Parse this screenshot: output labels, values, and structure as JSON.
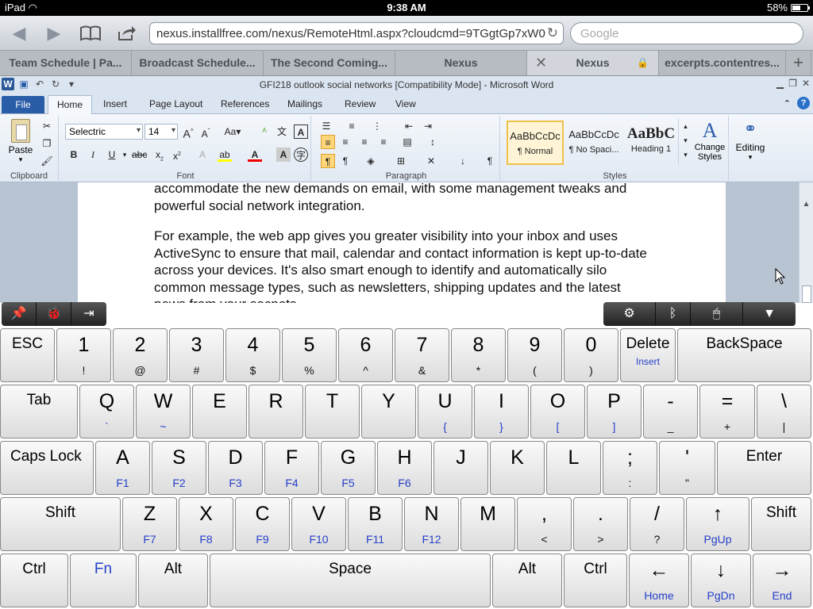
{
  "status": {
    "device": "iPad",
    "time": "9:38 AM",
    "battery": "58%",
    "battery_fraction": 0.58
  },
  "safari": {
    "url": "nexus.installfree.com/nexus/RemoteHtml.aspx?cloudcmd=9TGgtGp7xW0",
    "search_placeholder": "Google"
  },
  "tabs": [
    {
      "label": "Team Schedule | Pa..."
    },
    {
      "label": "Broadcast Schedule..."
    },
    {
      "label": "The Second Coming..."
    },
    {
      "label": "Nexus"
    },
    {
      "label": "Nexus"
    },
    {
      "label": "excerpts.contentres..."
    }
  ],
  "word": {
    "title": "GFI218 outlook social networks [Compatibility Mode] - Microsoft Word",
    "ribbon_tabs": {
      "file": "File",
      "home": "Home",
      "insert": "Insert",
      "page_layout": "Page Layout",
      "references": "References",
      "mailings": "Mailings",
      "review": "Review",
      "view": "View"
    },
    "clipboard": {
      "paste": "Paste",
      "label": "Clipboard"
    },
    "font": {
      "name": "Selectric",
      "size": "14",
      "label": "Font"
    },
    "paragraph": {
      "label": "Paragraph"
    },
    "styles": {
      "label": "Styles",
      "items": [
        {
          "sample": "AaBbCcDc",
          "name": "¶ Normal"
        },
        {
          "sample": "AaBbCcDc",
          "name": "¶ No Spaci..."
        },
        {
          "sample": "AaBbC",
          "name": "Heading 1"
        }
      ],
      "change_styles": "Change Styles"
    },
    "editing": {
      "label": "Editing"
    },
    "document": {
      "para1": "accommodate the new demands on email, with some management tweaks and powerful social network integration.",
      "para2": "For example, the web app gives you greater visibility into your inbox and uses ActiveSync to ensure that mail, calendar and contact information is kept up-to-date across your devices. It's also smart enough to identify and automatically silo common message types, such as newsletters, shipping updates and the latest news from your socnets."
    }
  },
  "keyboard": {
    "row1": [
      {
        "main": "ESC"
      },
      {
        "main": "1",
        "sub": "!"
      },
      {
        "main": "2",
        "sub": "@"
      },
      {
        "main": "3",
        "sub": "#"
      },
      {
        "main": "4",
        "sub": "$"
      },
      {
        "main": "5",
        "sub": "%"
      },
      {
        "main": "6",
        "sub": "^"
      },
      {
        "main": "7",
        "sub": "&"
      },
      {
        "main": "8",
        "sub": "*"
      },
      {
        "main": "9",
        "sub": "("
      },
      {
        "main": "0",
        "sub": ")"
      },
      {
        "main": "Delete",
        "sub": "Insert"
      },
      {
        "main": "BackSpace"
      }
    ],
    "row2": [
      {
        "main": "Tab"
      },
      {
        "main": "Q",
        "sub": "`"
      },
      {
        "main": "W",
        "sub": "~"
      },
      {
        "main": "E"
      },
      {
        "main": "R"
      },
      {
        "main": "T"
      },
      {
        "main": "Y"
      },
      {
        "main": "U",
        "sub": "{"
      },
      {
        "main": "I",
        "sub": "}"
      },
      {
        "main": "O",
        "sub": "["
      },
      {
        "main": "P",
        "sub": "]"
      },
      {
        "main": "-",
        "sub": "_"
      },
      {
        "main": "=",
        "sub": "+"
      },
      {
        "main": "\\",
        "sub": "|"
      }
    ],
    "row3": [
      {
        "main": "Caps Lock"
      },
      {
        "main": "A",
        "sub": "F1"
      },
      {
        "main": "S",
        "sub": "F2"
      },
      {
        "main": "D",
        "sub": "F3"
      },
      {
        "main": "F",
        "sub": "F4"
      },
      {
        "main": "G",
        "sub": "F5"
      },
      {
        "main": "H",
        "sub": "F6"
      },
      {
        "main": "J"
      },
      {
        "main": "K"
      },
      {
        "main": "L"
      },
      {
        "main": ";",
        "sub": ":"
      },
      {
        "main": "'",
        "sub": "\""
      },
      {
        "main": "Enter"
      }
    ],
    "row4": [
      {
        "main": "Shift"
      },
      {
        "main": "Z",
        "sub": "F7"
      },
      {
        "main": "X",
        "sub": "F8"
      },
      {
        "main": "C",
        "sub": "F9"
      },
      {
        "main": "V",
        "sub": "F10"
      },
      {
        "main": "B",
        "sub": "F11"
      },
      {
        "main": "N",
        "sub": "F12"
      },
      {
        "main": "M"
      },
      {
        "main": ",",
        "sub": "<"
      },
      {
        "main": ".",
        "sub": ">"
      },
      {
        "main": "/",
        "sub": "?"
      },
      {
        "main": "↑",
        "sub": "PgUp"
      },
      {
        "main": "Shift"
      }
    ],
    "row5": [
      {
        "main": "Ctrl"
      },
      {
        "main": "Fn"
      },
      {
        "main": "Alt"
      },
      {
        "main": "Space"
      },
      {
        "main": "Alt"
      },
      {
        "main": "Ctrl"
      },
      {
        "main": "←",
        "sub": "Home"
      },
      {
        "main": "↓",
        "sub": "PgDn"
      },
      {
        "main": "→",
        "sub": "End"
      }
    ]
  },
  "colors": {
    "accent_blue": "#2540c8",
    "file_tab": "#2a5da8"
  }
}
